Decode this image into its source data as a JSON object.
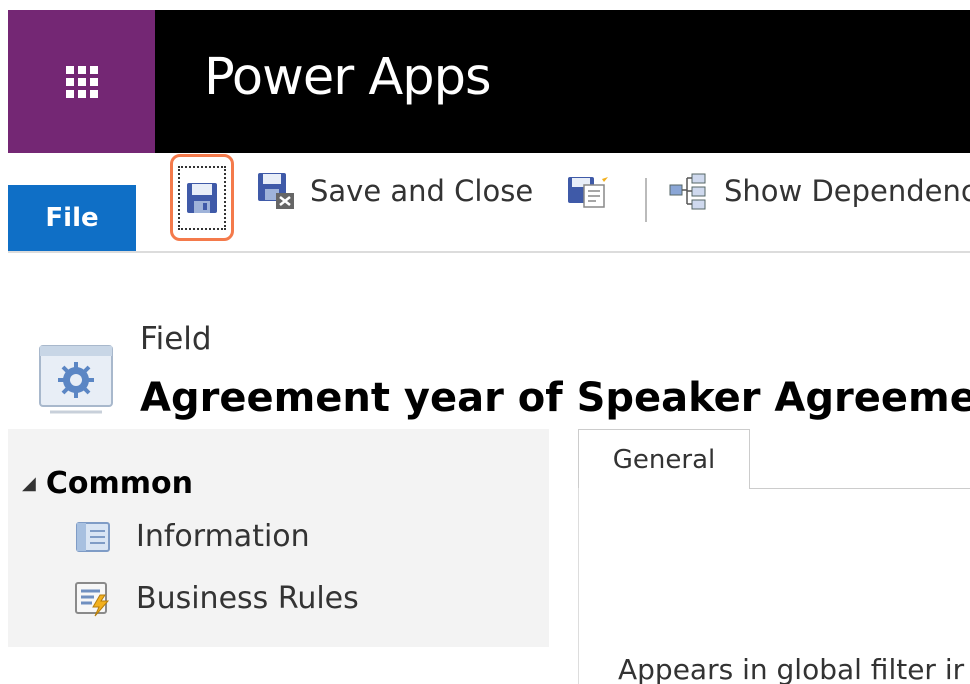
{
  "app": {
    "title": "Power Apps"
  },
  "ribbon": {
    "file_label": "File",
    "save_and_close_label": "Save and Close",
    "show_dependencies_label": "Show Dependenc"
  },
  "header": {
    "entity_type": "Field",
    "record_title": "Agreement year of Speaker Agreemer"
  },
  "nav": {
    "group_label": "Common",
    "items": [
      {
        "label": "Information"
      },
      {
        "label": "Business Rules"
      }
    ]
  },
  "main": {
    "tabs": [
      {
        "label": "General"
      }
    ],
    "partial_text": "Appears in global filter ir"
  }
}
